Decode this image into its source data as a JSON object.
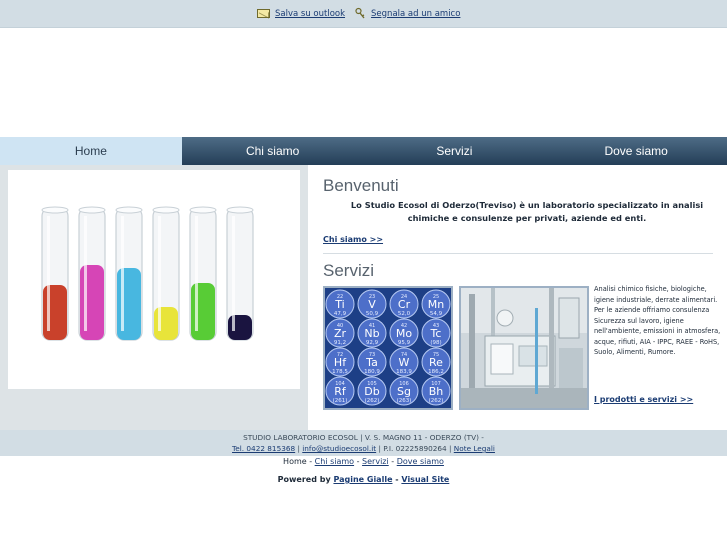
{
  "toplinks": {
    "outlook": "Salva su outlook",
    "friend": "Segnala ad un amico"
  },
  "nav": [
    "Home",
    "Chi siamo",
    "Servizi",
    "Dove siamo"
  ],
  "welcome": {
    "title": "Benvenuti",
    "text": "Lo Studio Ecosol di Oderzo(Treviso) è un laboratorio specializzato in analisi chimiche e consulenze per privati, aziende ed enti.",
    "more": "Chi siamo >>"
  },
  "services": {
    "title": "Servizi",
    "description": "Analisi chimico fisiche, biologiche, igiene industriale, derrate alimentari. Per le aziende offriamo consulenza Sicurezza sul lavoro, igiene nell'ambiente, emissioni in atmosfera, acque, rifiuti, AIA - IPPC, RAEE - RoHS, Suolo, Alimenti, Rumore.",
    "more": "I prodotti e servizi >>"
  },
  "elements": [
    {
      "n": "22",
      "s": "Ti",
      "w": "47,9"
    },
    {
      "n": "23",
      "s": "V",
      "w": "50,9"
    },
    {
      "n": "24",
      "s": "Cr",
      "w": "52,0"
    },
    {
      "n": "25",
      "s": "Mn",
      "w": "54,9"
    },
    {
      "n": "40",
      "s": "Zr",
      "w": "91,2"
    },
    {
      "n": "41",
      "s": "Nb",
      "w": "92,9"
    },
    {
      "n": "42",
      "s": "Mo",
      "w": "95,9"
    },
    {
      "n": "43",
      "s": "Tc",
      "w": "(98)"
    },
    {
      "n": "72",
      "s": "Hf",
      "w": "178,5"
    },
    {
      "n": "73",
      "s": "Ta",
      "w": "180,9"
    },
    {
      "n": "74",
      "s": "W",
      "w": "183,9"
    },
    {
      "n": "75",
      "s": "Re",
      "w": "186,2"
    },
    {
      "n": "104",
      "s": "Rf",
      "w": "(261)"
    },
    {
      "n": "105",
      "s": "Db",
      "w": "(262)"
    },
    {
      "n": "106",
      "s": "Sg",
      "w": "(263)"
    },
    {
      "n": "107",
      "s": "Bh",
      "w": "(262)"
    }
  ],
  "tubes": [
    "#c9412b",
    "#d645b6",
    "#48b7e0",
    "#e8e43a",
    "#58cc36",
    "#1a1440"
  ],
  "footer": {
    "line1": "STUDIO LABORATORIO ECOSOL | V. S. MAGNO 11 - ODERZO (TV) -",
    "phone": "Tel. 0422 815368",
    "sep1": " | ",
    "email": "info@studioecosol.it",
    "piva": " | P.I. 02225890264 | ",
    "legal": "Note Legali"
  },
  "bottomnav": {
    "home": "Home",
    "sep": " - ",
    "chi": "Chi siamo",
    "servizi": "Servizi",
    "dove": "Dove siamo"
  },
  "powered": {
    "label": "Powered by ",
    "pg": "Pagine Gialle",
    "sep": " - ",
    "vs": "Visual Site"
  },
  "colors": {
    "nav_active": "#cfe4f3",
    "nav_bg": "#3a566f",
    "link": "#1b3c73",
    "bar": "#d2dde4"
  }
}
